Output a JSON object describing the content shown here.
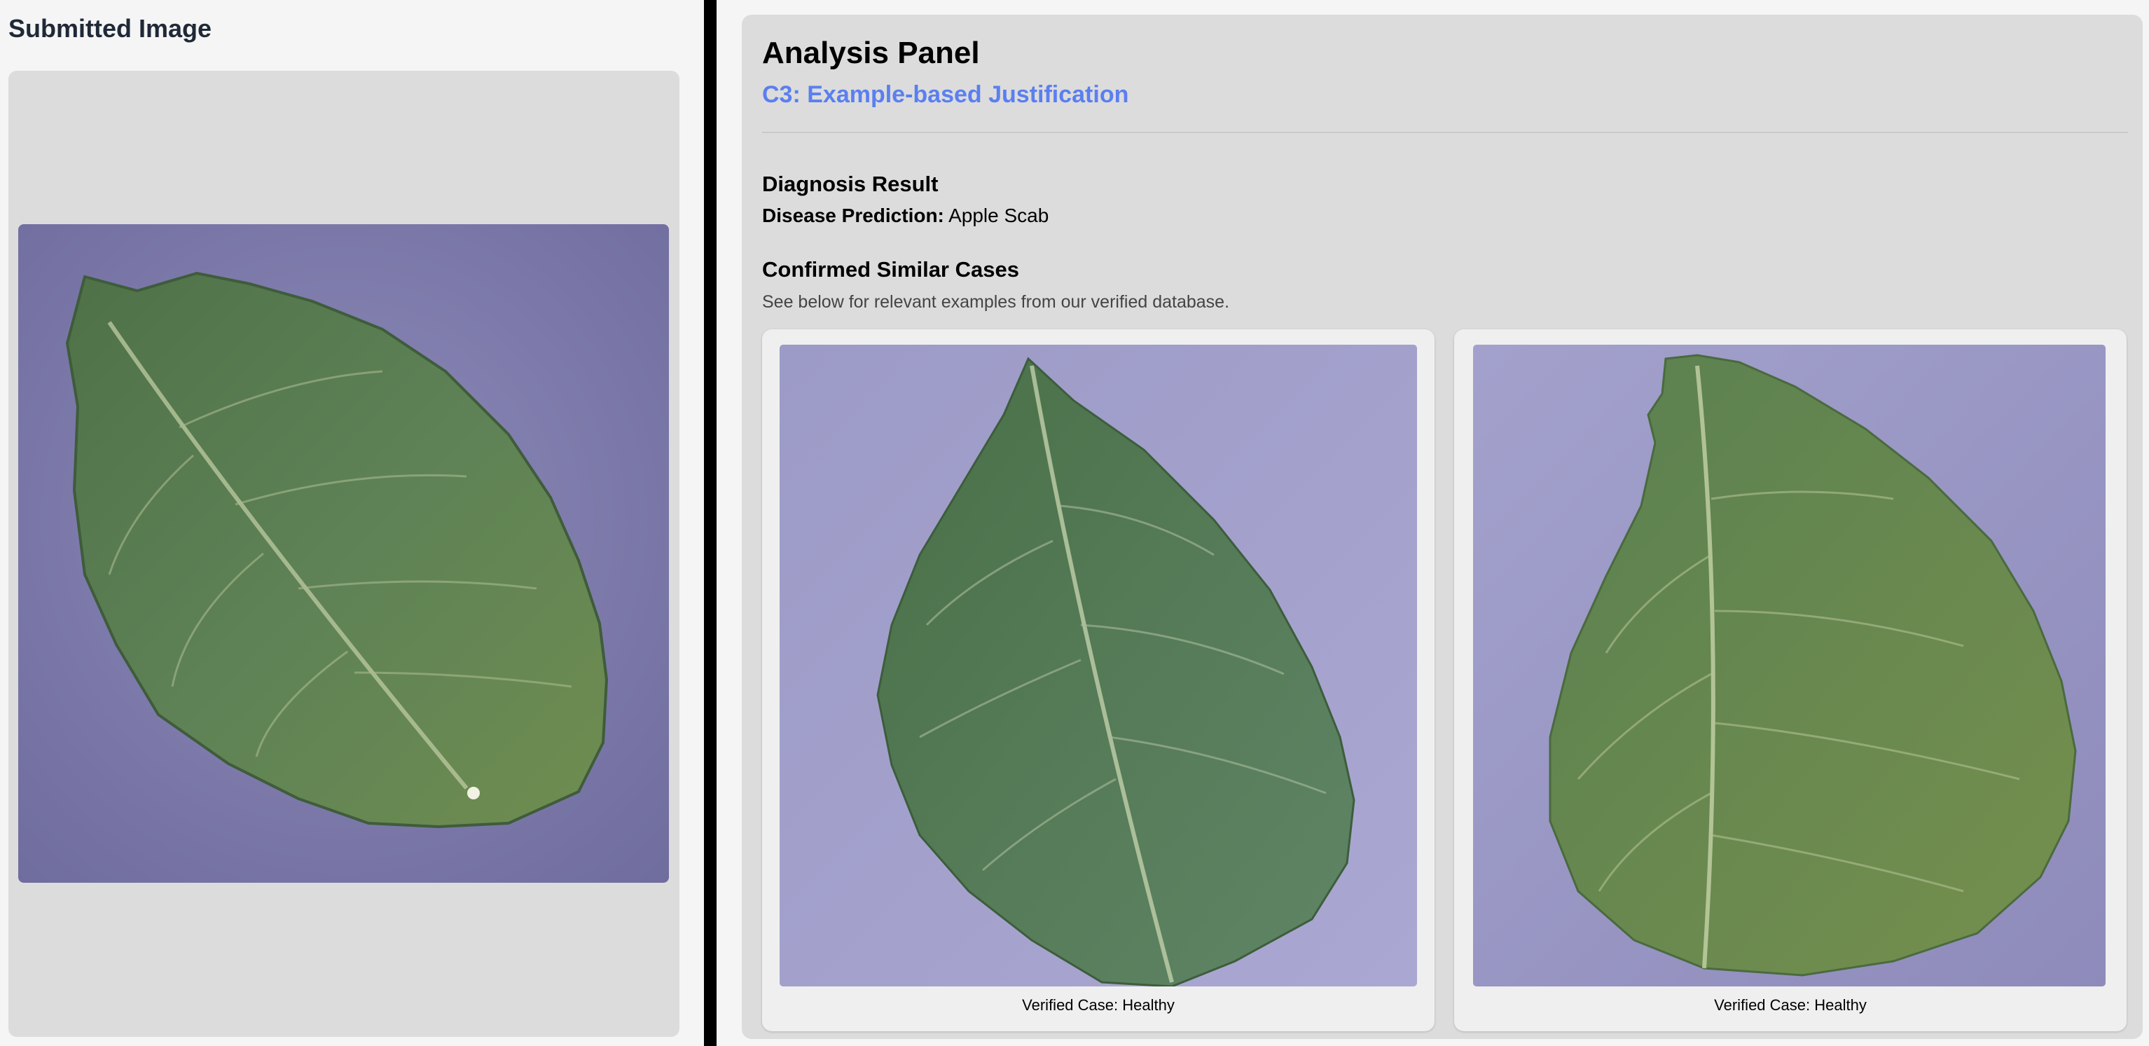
{
  "submitted": {
    "title": "Submitted Image"
  },
  "analysis": {
    "title": "Analysis Panel",
    "subtitle": "C3: Example-based Justification",
    "diagnosis_heading": "Diagnosis Result",
    "prediction_label": "Disease Prediction:",
    "prediction_value": "Apple Scab",
    "similar_heading": "Confirmed Similar Cases",
    "similar_description": "See below for relevant examples from our verified database.",
    "cases": [
      {
        "caption": "Verified Case: Healthy"
      },
      {
        "caption": "Verified Case: Healthy"
      }
    ]
  },
  "colors": {
    "accent": "#5b7ff0",
    "panel_bg": "#dcdcdc",
    "card_bg": "#efefef",
    "divider": "#000000",
    "photo_background": "#9a98c4",
    "leaf_green": "#5c7f4e"
  }
}
